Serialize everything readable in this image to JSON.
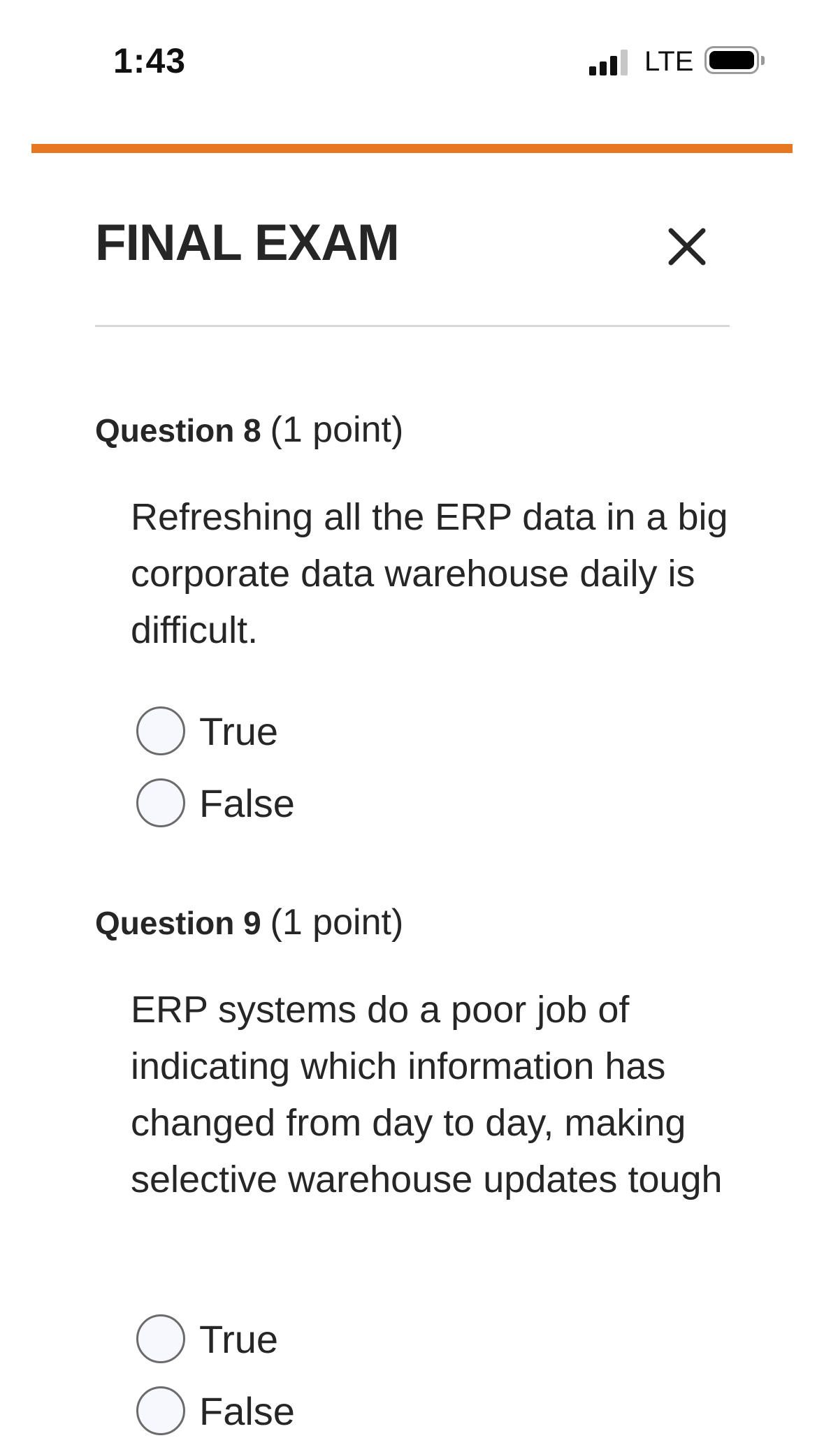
{
  "status_bar": {
    "time": "1:43",
    "network": "LTE",
    "icons": [
      "cellular-signal-icon",
      "battery-icon"
    ]
  },
  "header": {
    "title": "FINAL EXAM",
    "close_icon": "close-icon"
  },
  "colors": {
    "accent": "#e87722",
    "text": "#262626",
    "divider": "#d8d8d8",
    "radio_fill": "#f6f8fe"
  },
  "questions": [
    {
      "label": "Question 8",
      "points": "(1 point)",
      "text": "Refreshing all the ERP data in a big corporate data warehouse daily is difficult.",
      "options": [
        {
          "label": "True",
          "selected": false
        },
        {
          "label": "False",
          "selected": false
        }
      ]
    },
    {
      "label": "Question 9",
      "points": "(1 point)",
      "text": "ERP systems do a poor job of indicating which information has changed from day to day, making selective warehouse updates tough",
      "options": [
        {
          "label": "True",
          "selected": false
        },
        {
          "label": "False",
          "selected": false
        }
      ]
    }
  ]
}
